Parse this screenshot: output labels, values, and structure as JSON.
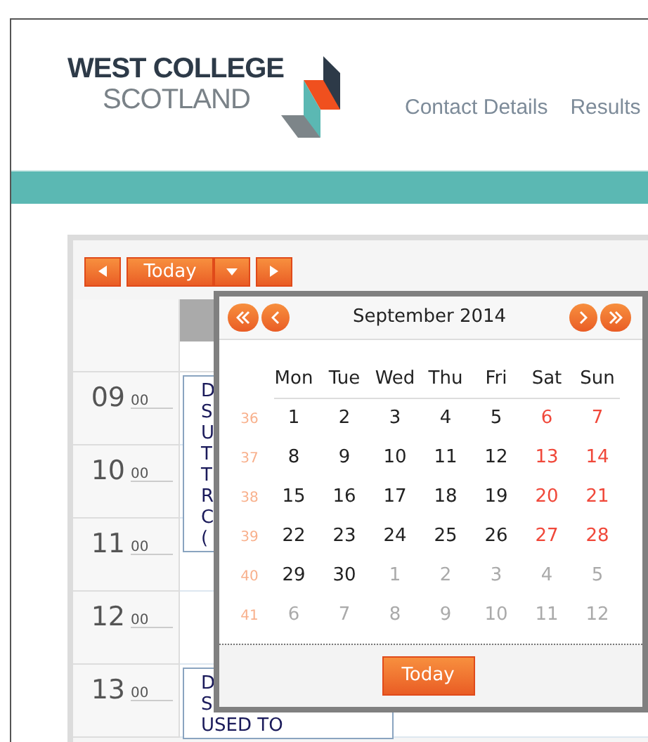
{
  "header": {
    "logo_line1": "WEST COLLEGE",
    "logo_line2": "SCOTLAND",
    "nav": [
      {
        "label": "Contact Details"
      },
      {
        "label": "Results"
      }
    ]
  },
  "toolbar": {
    "today_button": "Today"
  },
  "scheduler": {
    "hours": [
      {
        "hour": "09",
        "minutes": "00",
        "event": {
          "lines": [
            "D",
            "S",
            "U",
            "T",
            "T",
            "R",
            "C",
            "("
          ]
        }
      },
      {
        "hour": "10",
        "minutes": "00"
      },
      {
        "hour": "11",
        "minutes": "00"
      },
      {
        "hour": "12",
        "minutes": "00"
      },
      {
        "hour": "13",
        "minutes": "00",
        "event": {
          "lines": [
            "D",
            "S",
            "USED TO"
          ]
        }
      }
    ]
  },
  "datepicker": {
    "title": "September 2014",
    "weekdays": [
      "Mon",
      "Tue",
      "Wed",
      "Thu",
      "Fri",
      "Sat",
      "Sun"
    ],
    "weeks": [
      {
        "number": "36",
        "days": [
          {
            "label": "1",
            "kind": "weekday"
          },
          {
            "label": "2",
            "kind": "weekday"
          },
          {
            "label": "3",
            "kind": "weekday"
          },
          {
            "label": "4",
            "kind": "weekday"
          },
          {
            "label": "5",
            "kind": "weekday"
          },
          {
            "label": "6",
            "kind": "weekend"
          },
          {
            "label": "7",
            "kind": "weekend"
          }
        ]
      },
      {
        "number": "37",
        "days": [
          {
            "label": "8",
            "kind": "weekday"
          },
          {
            "label": "9",
            "kind": "weekday"
          },
          {
            "label": "10",
            "kind": "weekday"
          },
          {
            "label": "11",
            "kind": "weekday"
          },
          {
            "label": "12",
            "kind": "weekday"
          },
          {
            "label": "13",
            "kind": "weekend"
          },
          {
            "label": "14",
            "kind": "weekend"
          }
        ]
      },
      {
        "number": "38",
        "days": [
          {
            "label": "15",
            "kind": "weekday"
          },
          {
            "label": "16",
            "kind": "weekday"
          },
          {
            "label": "17",
            "kind": "weekday"
          },
          {
            "label": "18",
            "kind": "weekday"
          },
          {
            "label": "19",
            "kind": "weekday"
          },
          {
            "label": "20",
            "kind": "weekend"
          },
          {
            "label": "21",
            "kind": "weekend"
          }
        ]
      },
      {
        "number": "39",
        "days": [
          {
            "label": "22",
            "kind": "weekday"
          },
          {
            "label": "23",
            "kind": "weekday"
          },
          {
            "label": "24",
            "kind": "weekday"
          },
          {
            "label": "25",
            "kind": "weekday"
          },
          {
            "label": "26",
            "kind": "weekday"
          },
          {
            "label": "27",
            "kind": "weekend"
          },
          {
            "label": "28",
            "kind": "weekend"
          }
        ]
      },
      {
        "number": "40",
        "days": [
          {
            "label": "29",
            "kind": "weekday"
          },
          {
            "label": "30",
            "kind": "weekday"
          },
          {
            "label": "1",
            "kind": "other"
          },
          {
            "label": "2",
            "kind": "other"
          },
          {
            "label": "3",
            "kind": "other"
          },
          {
            "label": "4",
            "kind": "other"
          },
          {
            "label": "5",
            "kind": "other"
          }
        ]
      },
      {
        "number": "41",
        "days": [
          {
            "label": "6",
            "kind": "other"
          },
          {
            "label": "7",
            "kind": "other"
          },
          {
            "label": "8",
            "kind": "other"
          },
          {
            "label": "9",
            "kind": "other"
          },
          {
            "label": "10",
            "kind": "other"
          },
          {
            "label": "11",
            "kind": "other"
          },
          {
            "label": "12",
            "kind": "other"
          }
        ]
      }
    ],
    "today_button": "Today"
  }
}
